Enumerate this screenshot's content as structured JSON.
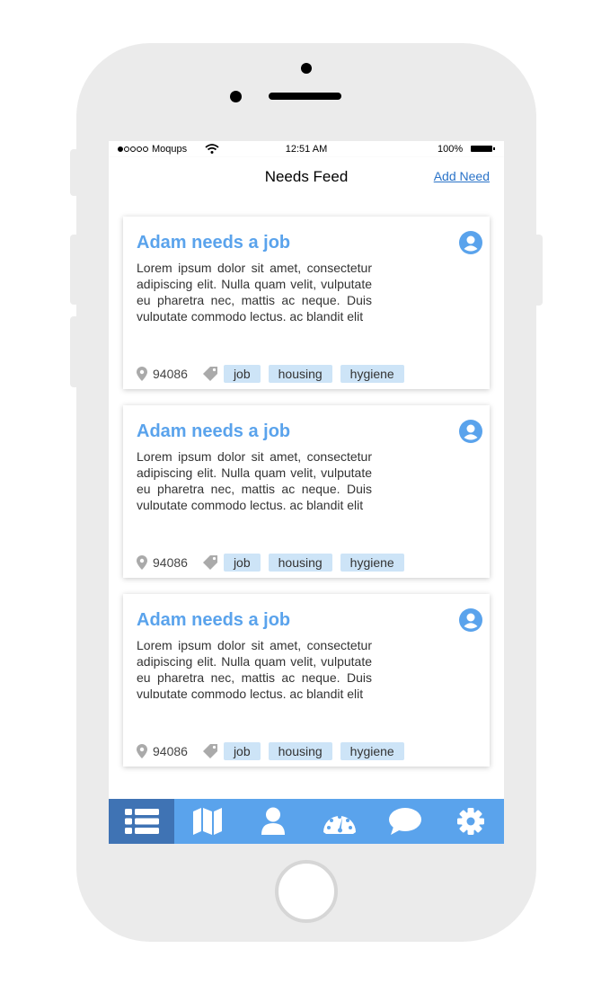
{
  "status_bar": {
    "carrier": "Moqups",
    "time": "12:51 AM",
    "battery": "100%"
  },
  "nav": {
    "title": "Needs Feed",
    "add_need": "Add Need"
  },
  "cards": [
    {
      "title": "Adam needs a job",
      "description": "Lorem ipsum dolor sit amet, consectetur adipiscing elit. Nulla quam velit, vulputate eu pharetra nec, mattis ac neque. Duis vulputate commodo lectus, ac blandit elit",
      "zip": "94086",
      "tags": [
        "job",
        "housing",
        "hygiene"
      ]
    },
    {
      "title": "Adam needs a job",
      "description": "Lorem ipsum dolor sit amet, consectetur adipiscing elit. Nulla quam velit, vulputate eu pharetra nec, mattis ac neque. Duis vulputate commodo lectus, ac blandit elit",
      "zip": "94086",
      "tags": [
        "job",
        "housing",
        "hygiene"
      ]
    },
    {
      "title": "Adam needs a job",
      "description": "Lorem ipsum dolor sit amet, consectetur adipiscing elit. Nulla quam velit, vulputate eu pharetra nec, mattis ac neque. Duis vulputate commodo lectus, ac blandit elit",
      "zip": "94086",
      "tags": [
        "job",
        "housing",
        "hygiene"
      ]
    }
  ],
  "tab_bar": {
    "items": [
      "list-icon",
      "map-icon",
      "user-icon",
      "dashboard-icon",
      "chat-icon",
      "gear-icon"
    ],
    "active": "list-icon"
  },
  "colors": {
    "accent": "#5aa3ec",
    "active_tab": "#3f73b4",
    "tag_bg": "#cde4f7",
    "link": "#2a73c8"
  }
}
